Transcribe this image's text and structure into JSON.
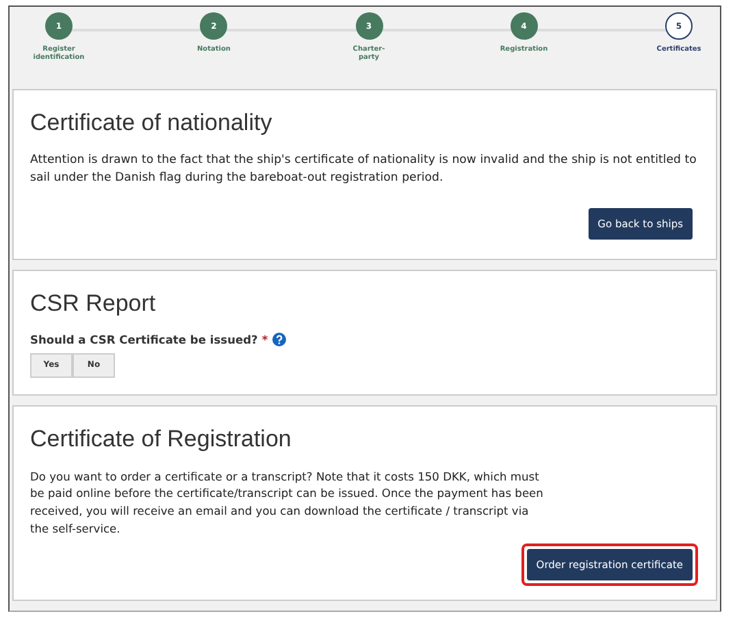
{
  "steps": [
    {
      "number": "1",
      "label": "Register identification",
      "completed": true
    },
    {
      "number": "2",
      "label": "Notation",
      "completed": true
    },
    {
      "number": "3",
      "label": "Charter-party",
      "completed": true
    },
    {
      "number": "4",
      "label": "Registration",
      "completed": true
    },
    {
      "number": "5",
      "label": "Certificates",
      "completed": false
    }
  ],
  "nationality": {
    "title": "Certificate of nationality",
    "text": "Attention is drawn to the fact that the ship's certificate of nationality is now invalid and the ship is not entitled to sail under the Danish flag during the bareboat-out registration period.",
    "button": {
      "label": "Go back to ships",
      "highlighted": false
    }
  },
  "csr": {
    "title": "CSR Report",
    "question": "Should a CSR Certificate be issued?",
    "required_mark": "*",
    "options": [
      {
        "label": "Yes",
        "selected": false
      },
      {
        "label": "No",
        "selected": false
      }
    ]
  },
  "registration": {
    "title": "Certificate of Registration",
    "text": "Do you want to order a certificate or a transcript? Note that it costs 150 DKK, which must be paid online before the certificate/transcript can be issued. Once the payment has been received, you will receive an email and you can download the certificate / transcript via the self-service.",
    "button": {
      "label": "Order registration certificate",
      "highlighted": true
    }
  }
}
